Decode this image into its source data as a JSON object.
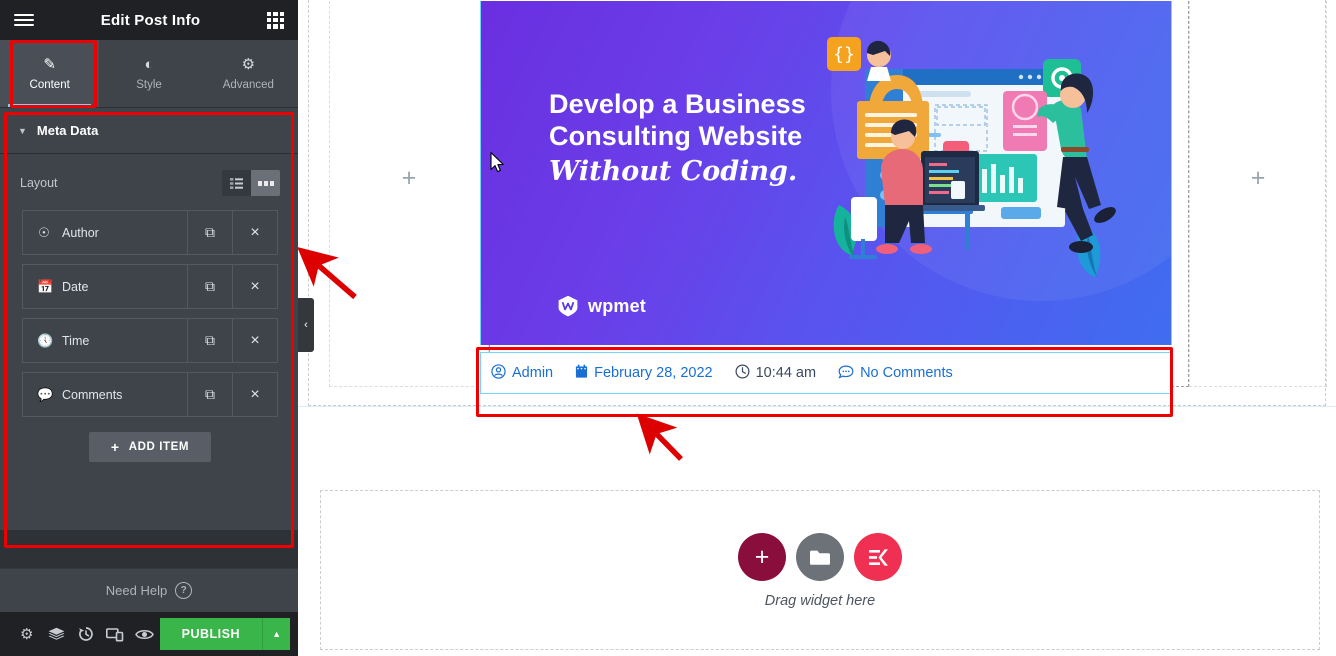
{
  "panel": {
    "header": {
      "title": "Edit Post Info",
      "menu_icon": "hamburger-icon",
      "grid_icon": "apps-grid-icon"
    },
    "tabs": [
      {
        "label": "Content",
        "icon": "pencil-icon",
        "active": true
      },
      {
        "label": "Style",
        "icon": "contrast-icon",
        "active": false
      },
      {
        "label": "Advanced",
        "icon": "gear-icon",
        "active": false
      }
    ],
    "section": {
      "title": "Meta Data",
      "caret": "▼"
    },
    "layout_control": {
      "label": "Layout",
      "options": [
        {
          "icon": "list-icon",
          "selected": false
        },
        {
          "icon": "dots-inline-icon",
          "selected": true
        }
      ]
    },
    "repeater": {
      "items": [
        {
          "label": "Author",
          "icon": "user-circle-icon",
          "duplicate": "copy-icon",
          "remove": "×"
        },
        {
          "label": "Date",
          "icon": "calendar-icon",
          "duplicate": "copy-icon",
          "remove": "×"
        },
        {
          "label": "Time",
          "icon": "clock-icon",
          "duplicate": "copy-icon",
          "remove": "×"
        },
        {
          "label": "Comments",
          "icon": "comment-icon",
          "duplicate": "copy-icon",
          "remove": "×"
        }
      ],
      "add_label": "ADD ITEM",
      "add_plus": "+"
    },
    "need_help": {
      "label": "Need Help",
      "badge": "?"
    },
    "footer": {
      "icons": [
        {
          "name": "settings-gear-icon"
        },
        {
          "name": "navigator-layers-icon"
        },
        {
          "name": "history-revisions-icon"
        },
        {
          "name": "responsive-mode-icon"
        },
        {
          "name": "preview-eye-icon"
        }
      ],
      "publish_label": "PUBLISH",
      "publish_arrow": "▲"
    },
    "collapse_arrow": "‹"
  },
  "canvas": {
    "column_placeholder": "+",
    "banner": {
      "line1": "Develop a Business",
      "line2": "Consulting Website",
      "line3": "Without Coding.",
      "brand": "wpmet"
    },
    "meta_widget": {
      "items": [
        {
          "label": "Admin",
          "icon": "user-circle-icon",
          "style": "link"
        },
        {
          "label": "February 28, 2022",
          "icon": "calendar-icon",
          "style": "link"
        },
        {
          "label": "10:44 am",
          "icon": "clock-icon",
          "style": "dark"
        },
        {
          "label": "No Comments",
          "icon": "comment-icon",
          "style": "link"
        }
      ]
    },
    "dropzone": {
      "label": "Drag widget here",
      "buttons": [
        {
          "name": "add-section-button",
          "glyph": "+",
          "color": "#8a0e3c"
        },
        {
          "name": "template-folder-button",
          "glyph": "folder-icon",
          "color": "#6d7278"
        },
        {
          "name": "elementskit-button",
          "glyph": "EK-logo",
          "color": "#f03052"
        }
      ]
    }
  },
  "annotations": {
    "highlight_color": "#ee0000",
    "boxes": [
      "content-tab",
      "meta-data-panel",
      "post-meta-widget"
    ],
    "arrows": 2
  },
  "colors": {
    "panel_bg": "#3f444b",
    "panel_dark": "#1f2124",
    "accent_tab": "#71d7f7",
    "publish_green": "#39b54a",
    "link_blue": "#1a6fd4",
    "highlight_red": "#ee0000"
  }
}
